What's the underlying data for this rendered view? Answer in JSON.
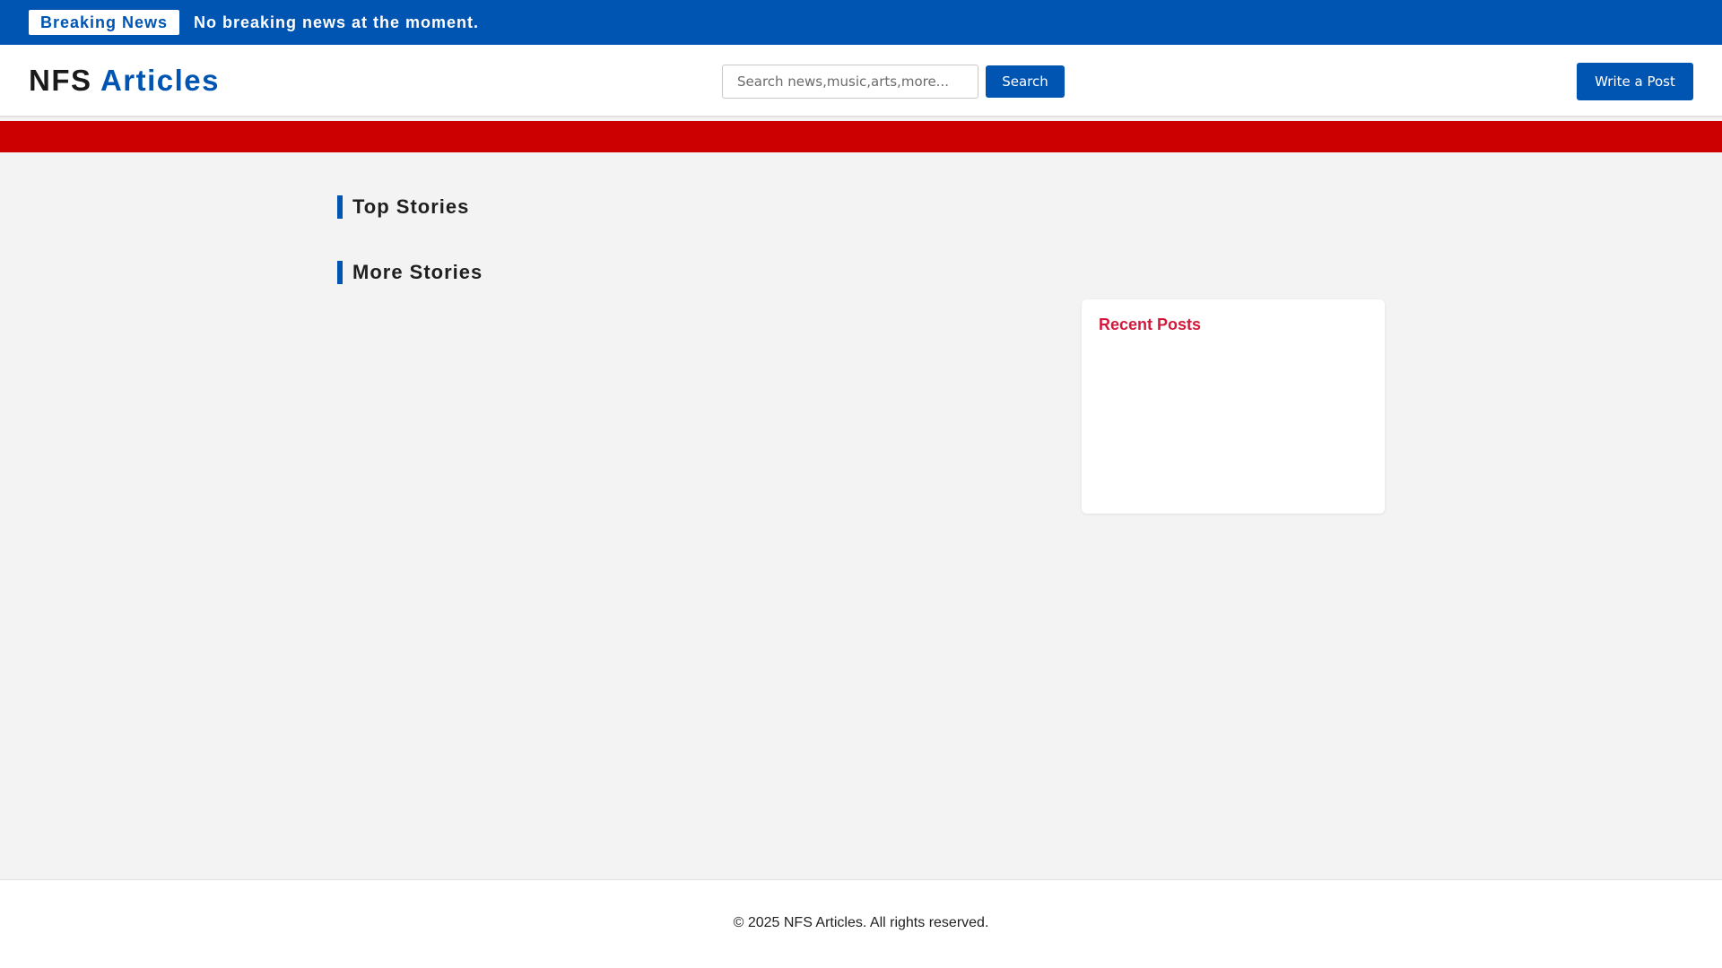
{
  "breaking": {
    "badge_label": "Breaking News",
    "message": "No breaking news at the moment."
  },
  "header": {
    "logo_prefix": "NFS",
    "logo_accent": "Articles",
    "search_placeholder": "Search news,music,arts,more...",
    "search_button_label": "Search",
    "write_button_label": "Write a Post"
  },
  "main": {
    "top_stories_heading": "Top Stories",
    "more_stories_heading": "More Stories"
  },
  "sidebar": {
    "recent_posts_title": "Recent Posts"
  },
  "footer": {
    "copyright": "© 2025 NFS Articles. All rights reserved."
  },
  "colors": {
    "brand_blue": "#0055b3",
    "nav_red": "#cc0000",
    "accent_crimson": "#d11a3c",
    "page_background": "#f3f3f3"
  }
}
